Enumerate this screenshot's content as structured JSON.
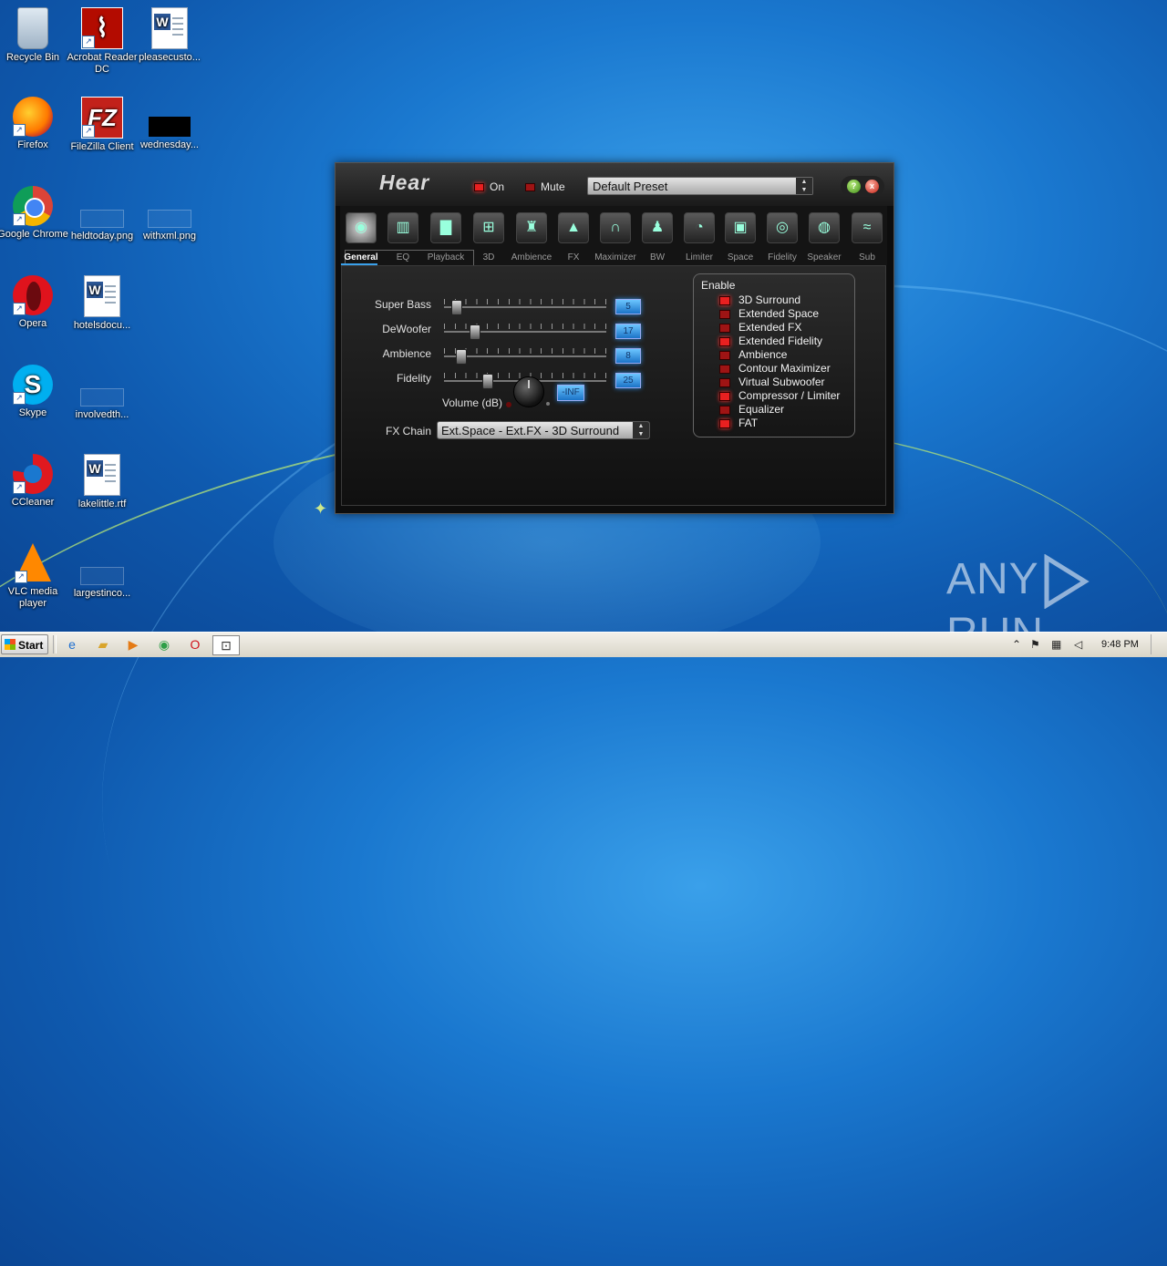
{
  "desktop": {
    "icons": [
      {
        "label": "Recycle Bin"
      },
      {
        "label": "Acrobat Reader DC"
      },
      {
        "label": "pleasecusto..."
      },
      {
        "label": "Firefox"
      },
      {
        "label": "FileZilla Client"
      },
      {
        "label": "wednesday..."
      },
      {
        "label": "Google Chrome"
      },
      {
        "label": "heldtoday.png"
      },
      {
        "label": "withxml.png"
      },
      {
        "label": "Opera"
      },
      {
        "label": "hotelsdocu..."
      },
      {
        "label": "Skype"
      },
      {
        "label": "involvedth..."
      },
      {
        "label": "CCleaner"
      },
      {
        "label": "lakelittle.rtf"
      },
      {
        "label": "VLC media player"
      },
      {
        "label": "largestinco..."
      }
    ]
  },
  "app": {
    "title": "Hear",
    "on_label": "On",
    "mute_label": "Mute",
    "preset": "Default Preset",
    "help_label": "?",
    "close_label": "x",
    "tabs": [
      {
        "label": "General",
        "icon": "speaker-cone-icon",
        "active": true
      },
      {
        "label": "EQ",
        "icon": "equalizer-icon"
      },
      {
        "label": "Playback",
        "icon": "spectrum-icon"
      },
      {
        "label": "3D",
        "icon": "surround-speakers-icon"
      },
      {
        "label": "Ambience",
        "icon": "ambience-icon"
      },
      {
        "label": "FX",
        "icon": "fx-icon"
      },
      {
        "label": "Maximizer",
        "icon": "headphones-icon"
      },
      {
        "label": "BW",
        "icon": "bw-icon"
      },
      {
        "label": "Limiter",
        "icon": "meter-icon"
      },
      {
        "label": "Space",
        "icon": "space-icon"
      },
      {
        "label": "Fidelity",
        "icon": "fidelity-icon"
      },
      {
        "label": "Speaker",
        "icon": "speaker-icon"
      },
      {
        "label": "Sub",
        "icon": "sub-icon"
      }
    ],
    "sliders": [
      {
        "label": "Super Bass",
        "value": "5",
        "level": 0.05
      },
      {
        "label": "DeWoofer",
        "value": "17",
        "level": 0.17
      },
      {
        "label": "Ambience",
        "value": "8",
        "level": 0.08
      },
      {
        "label": "Fidelity",
        "value": "25",
        "level": 0.25
      }
    ],
    "volume_label": "Volume (dB)",
    "volume_value": "-INF",
    "fx_chain_label": "FX Chain",
    "fx_chain_value": "Ext.Space - Ext.FX - 3D Surround",
    "enable_title": "Enable",
    "enable_items": [
      {
        "label": "3D Surround",
        "on": true
      },
      {
        "label": "Extended Space",
        "on": false
      },
      {
        "label": "Extended FX",
        "on": false
      },
      {
        "label": "Extended Fidelity",
        "on": true
      },
      {
        "label": "Ambience",
        "on": false
      },
      {
        "label": "Contour Maximizer",
        "on": false
      },
      {
        "label": "Virtual Subwoofer",
        "on": false
      },
      {
        "label": "Compressor / Limiter",
        "on": true
      },
      {
        "label": "Equalizer",
        "on": false
      },
      {
        "label": "FAT",
        "on": true
      }
    ]
  },
  "watermark": {
    "text_left": "ANY",
    "text_right": "RUN"
  },
  "taskbar": {
    "start_label": "Start",
    "clock": "9:48 PM"
  }
}
